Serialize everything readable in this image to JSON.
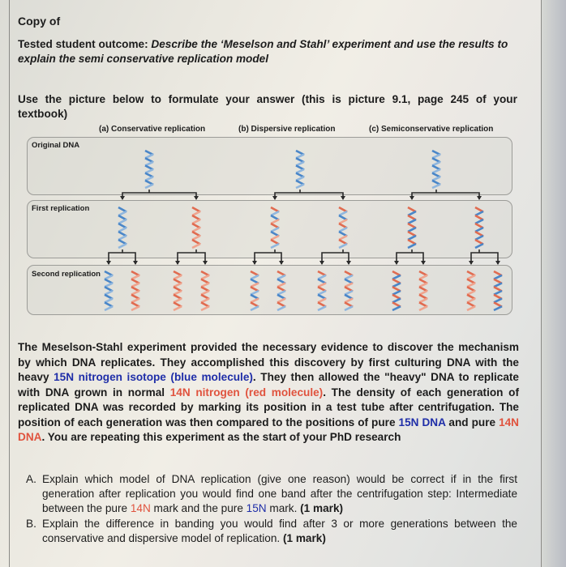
{
  "header": {
    "copy_of": "Copy of",
    "outcome_label": "Tested student outcome: ",
    "outcome_text": "Describe the ‘Meselson and Stahl’ experiment and use the results to explain the semi conservative replication model"
  },
  "instruction": {
    "line1_words": [
      "Use",
      "the",
      "picture",
      "below",
      "to",
      "formulate",
      "your",
      "answer",
      "(this",
      "is",
      "picture",
      "9.1,",
      "page",
      "245",
      "of",
      "your"
    ],
    "line2": "textbook)"
  },
  "figure": {
    "columns": [
      {
        "label": "(a) Conservative replication",
        "model": "conservative"
      },
      {
        "label": "(b) Dispersive replication",
        "model": "dispersive"
      },
      {
        "label": "(c) Semiconservative replication",
        "model": "semiconservative"
      }
    ],
    "bands": [
      {
        "label": "Original DNA"
      },
      {
        "label": "First replication"
      },
      {
        "label": "Second replication"
      }
    ],
    "colors": {
      "heavy_15N": "#4a86c8",
      "light_14N": "#e06b50",
      "arrow": "#2a2a2a"
    },
    "helices": {
      "original": [
        "blue",
        "blue",
        "blue"
      ],
      "first": [
        "blue",
        "red",
        "mixed",
        "mixed",
        "hybrid",
        "hybrid"
      ],
      "second": [
        "blue",
        "red",
        "red",
        "red",
        "mixed",
        "mixed",
        "mixed",
        "mixed",
        "hybrid",
        "red",
        "red",
        "hybrid"
      ]
    }
  },
  "paragraph": {
    "p1": "The Meselson-Stahl experiment provided the necessary evidence to discover the mechanism by which DNA replicates. They accomplished this discovery by first culturing DNA with the heavy ",
    "blue1": "15N nitrogen isotope (blue molecule)",
    "p2": ". They then allowed the \"heavy\" DNA to replicate with DNA grown in normal ",
    "red1": "14N nitrogen (red molecule)",
    "p3": ". The density of each generation of replicated DNA was recorded by marking its position in a test tube after centrifugation. The position of each generation was then compared to the positions of pure ",
    "blue2": "15N DNA",
    "p4": " and pure ",
    "red2": "14N DNA",
    "p5": ". You are repeating this experiment as the start of your PhD research"
  },
  "questions": [
    {
      "letter": "A.",
      "t1": "Explain which model of DNA replication (give one reason) would be correct if in the first generation after replication you would find one band after the centrifugation step: Intermediate between the pure ",
      "red": "14N",
      "t2": " mark and the pure ",
      "blue": "15N",
      "t3": " mark. ",
      "mark": "(1 mark)"
    },
    {
      "letter": "B.",
      "t1": "Explain the difference in banding you would find after 3 or more generations between the conservative and dispersive model of replication. ",
      "mark": "(1 mark)"
    }
  ]
}
